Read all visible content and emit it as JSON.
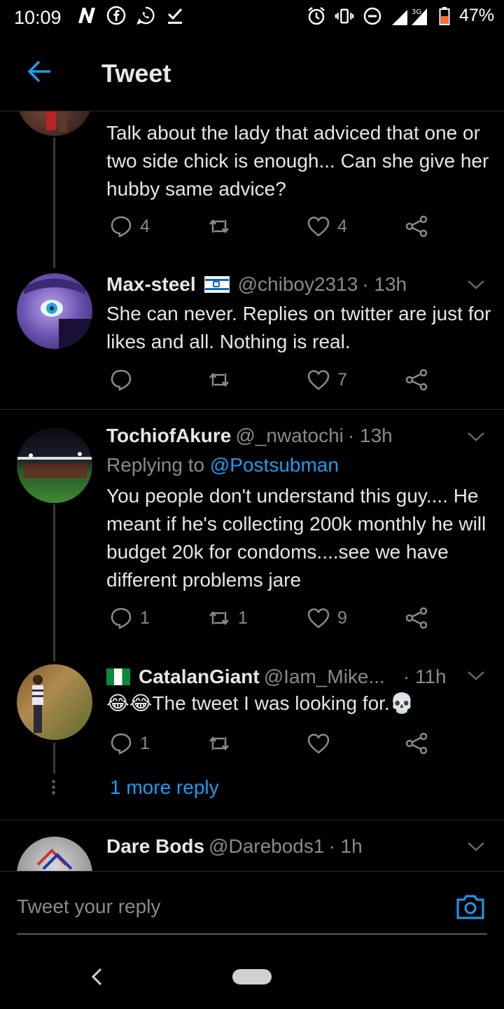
{
  "status_bar": {
    "time": "10:09",
    "battery_percent": "47%",
    "network": "3G",
    "left_icons": [
      "n-icon",
      "facebook-icon",
      "whatsapp-icon",
      "download-done-icon"
    ],
    "right_icons": [
      "alarm-icon",
      "vibrate-icon",
      "dnd-icon",
      "signal-icon",
      "battery-icon"
    ]
  },
  "header": {
    "title": "Tweet"
  },
  "tweets": [
    {
      "text": "Talk about the lady that adviced that one or two side chick is enough... Can she give her hubby same advice?",
      "replies": "4",
      "retweets": "",
      "likes": "4"
    },
    {
      "name": "Max-steel",
      "handle": "@chiboy2313",
      "time": "· 13h",
      "text": "She can never. Replies on twitter are just for likes and all. Nothing is real.",
      "replies": "",
      "retweets": "",
      "likes": "7"
    },
    {
      "name": "TochiofAkure",
      "handle": "@_nwatochi",
      "time": "· 13h",
      "replying_prefix": "Replying to ",
      "replying_to": "@Postsubman",
      "text": "You people don't understand this guy.... He meant if he's collecting 200k monthly he will budget 20k for condoms....see we have different problems jare",
      "replies": "1",
      "retweets": "1",
      "likes": "9"
    },
    {
      "name": "CatalanGiant",
      "handle": "@Iam_Mike...",
      "time": "· 11h",
      "emoji_prefix": "😂😂",
      "text": "The tweet I was looking for.",
      "emoji_suffix": "💀",
      "replies": "1",
      "retweets": "",
      "likes": "",
      "more_replies": "1 more reply"
    },
    {
      "name": "Dare Bods",
      "handle": "@Darebods1",
      "time": "· 1h"
    }
  ],
  "reply_box": {
    "placeholder": "Tweet your reply"
  },
  "colors": {
    "accent": "#1d9bf0",
    "background": "#000000",
    "muted": "#8a8a8a"
  }
}
